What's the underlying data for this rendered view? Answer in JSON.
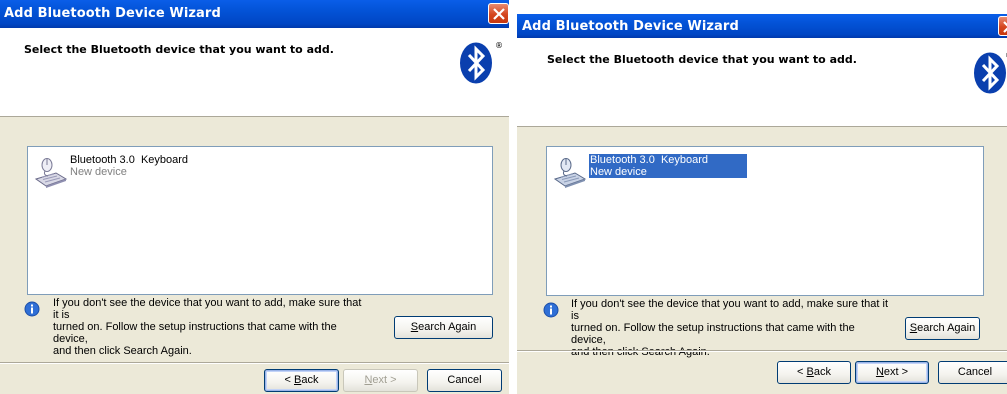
{
  "left": {
    "title": "Add Bluetooth Device Wizard",
    "header": "Select the Bluetooth device that you want to add.",
    "registered_mark": "®",
    "device": {
      "name": "Bluetooth 3.0  Keyboard",
      "status": "New device",
      "selected": false
    },
    "info_lines": [
      "If you don't see the device that you want to add, make sure that it is",
      "turned on. Follow the setup instructions that came with the device,",
      "and then click Search Again."
    ],
    "search_again": {
      "key": "S",
      "rest": "earch Again"
    },
    "back": {
      "prefix": "< ",
      "key": "B",
      "rest": "ack"
    },
    "next": {
      "key": "N",
      "rest": "ext >",
      "enabled": false
    },
    "cancel": "Cancel"
  },
  "right": {
    "title": "Add Bluetooth Device Wizard",
    "header": "Select the Bluetooth device that you want to add.",
    "registered_mark": "®",
    "device": {
      "name": "Bluetooth 3.0  Keyboard",
      "status": "New device",
      "selected": true
    },
    "info_lines": [
      "If you don't see the device that you want to add, make sure that it is",
      "turned on. Follow the setup instructions that came with the device,",
      "and then click Search Again."
    ],
    "search_again": {
      "key": "S",
      "rest": "earch Again"
    },
    "back": {
      "prefix": "< ",
      "key": "B",
      "rest": "ack"
    },
    "next": {
      "key": "N",
      "rest": "ext >",
      "enabled": true
    },
    "cancel": "Cancel"
  },
  "colors": {
    "titlebar": "#0352d6",
    "dialog_bg": "#ece9d8",
    "selection": "#316ac5",
    "close": "#d5461f"
  }
}
